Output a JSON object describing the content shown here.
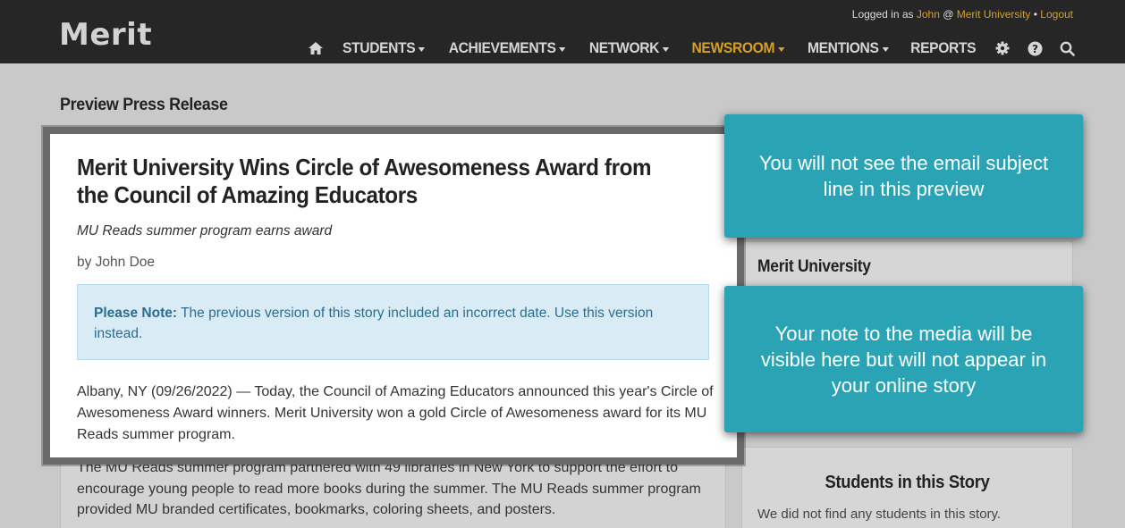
{
  "header": {
    "logo": "Merit",
    "user": {
      "prefix": "Logged in as ",
      "name": "John",
      "at": " @ ",
      "org": "Merit University",
      "sep": " • ",
      "logout": "Logout"
    },
    "nav": [
      {
        "label": "STUDENTS",
        "dropdown": true,
        "active": false
      },
      {
        "label": "ACHIEVEMENTS",
        "dropdown": true,
        "active": false
      },
      {
        "label": "NETWORK",
        "dropdown": true,
        "active": false
      },
      {
        "label": "NEWSROOM",
        "dropdown": true,
        "active": true
      },
      {
        "label": "MENTIONS",
        "dropdown": true,
        "active": false
      },
      {
        "label": "REPORTS",
        "dropdown": false,
        "active": false
      }
    ],
    "icons": [
      "home-icon",
      "gear-icon",
      "help-icon",
      "search-icon"
    ]
  },
  "page": {
    "title": "Preview Press Release"
  },
  "story": {
    "headline": "Merit University Wins Circle of Awesomeness Award from the Council of Amazing Educators",
    "subheadline": "MU Reads summer program earns award",
    "byline": "by John Doe",
    "note_label": "Please Note:",
    "note_text": " The previous version of this story included an incorrect date. Use this version instead.",
    "body": "Albany, NY (09/26/2022) — Today, the Council of Amazing Educators announced this year's Circle of Awesomeness Award winners. Merit University won a gold Circle of Awesomeness award for its MU Reads summer program.",
    "continued": "The MU Reads summer program partnered with 49 libraries in New York to support the effort to encourage young people to read more books during the summer. The MU Reads summer program provided MU branded certificates, bookmarks, coloring sheets, and posters."
  },
  "sidebar": {
    "org_title": "Merit University",
    "students_title": "Students in this Story",
    "students_empty": "We did not find any students in this story."
  },
  "callouts": {
    "subject": "You will not see the email subject line in this preview",
    "note": "Your note to the media will be visible here but will not appear in your online story"
  },
  "colors": {
    "topbar": "#262626",
    "accent": "#d4a029",
    "callout": "#2aa4b4",
    "note_bg": "#d9ecf6"
  }
}
